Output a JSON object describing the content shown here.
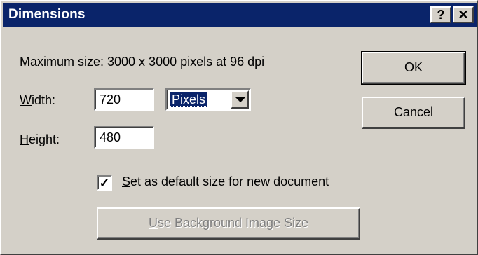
{
  "window": {
    "title": "Dimensions",
    "help_label": "?",
    "close_label": "✕"
  },
  "info": {
    "max_size_text": "Maximum size: 3000 x 3000 pixels at 96 dpi"
  },
  "width": {
    "label_accel": "W",
    "label_rest": "idth:",
    "value": "720"
  },
  "height": {
    "label_accel": "H",
    "label_rest": "eight:",
    "value": "480"
  },
  "units": {
    "selected": "Pixels"
  },
  "default_checkbox": {
    "checked": true,
    "check_mark": "✓",
    "label_accel": "S",
    "label_rest": "et as default size for new document"
  },
  "buttons": {
    "ok": "OK",
    "cancel": "Cancel",
    "bg_accel": "U",
    "bg_rest": "se Background Image Size",
    "bg_enabled": false
  },
  "colors": {
    "titlebar": "#0a246a",
    "face": "#d4d0c8",
    "disabled_text": "#808080"
  }
}
